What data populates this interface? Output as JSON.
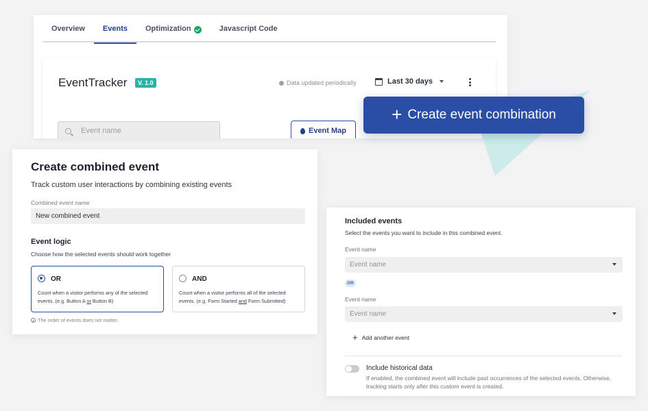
{
  "tabs": [
    {
      "label": "Overview"
    },
    {
      "label": "Events"
    },
    {
      "label": "Optimization"
    },
    {
      "label": "Javascript Code"
    }
  ],
  "tracker": {
    "title": "EventTracker",
    "version": "V. 1.0",
    "data_status": "Data updated periodically",
    "date_range": "Last 30 days",
    "search_placeholder": "Event name",
    "event_map_label": "Event Map"
  },
  "create_button": {
    "label": "Create event combination"
  },
  "combined_event": {
    "title": "Create combined event",
    "subtitle": "Track custom user interactions by combining existing events",
    "name_label": "Combined event name",
    "name_value": "New combined event",
    "logic_title": "Event logic",
    "logic_desc": "Choose how the selected events should work together",
    "or_option": {
      "label": "OR",
      "desc_1": "Count when a visitor performs any of the selected events. (e.g. Button A ",
      "desc_u": "or",
      "desc_2": " Button B)"
    },
    "and_option": {
      "label": "AND",
      "desc_1": "Count when a visitor performs all of the selected events. (e.g. Form Started ",
      "desc_u": "and",
      "desc_2": " Form Submitted)"
    },
    "note": "The order of events does not matter."
  },
  "included_events": {
    "title": "Included events",
    "subtitle": "Select the events you want to include in this combined event.",
    "event_label_1": "Event name",
    "event_placeholder_1": "Event name",
    "or_chip": "OR",
    "event_label_2": "Event name",
    "event_placeholder_2": "Event name",
    "add_event": "Add another event",
    "historical_title": "Include historical data",
    "historical_desc": "If enabled, the combined event will include past occurrences of the selected events. Otherwise, tracking starts only after this custom event is created."
  },
  "colors": {
    "primary": "#2a4ea6",
    "teal_badge": "#28b5a8",
    "success": "#1fa463"
  }
}
